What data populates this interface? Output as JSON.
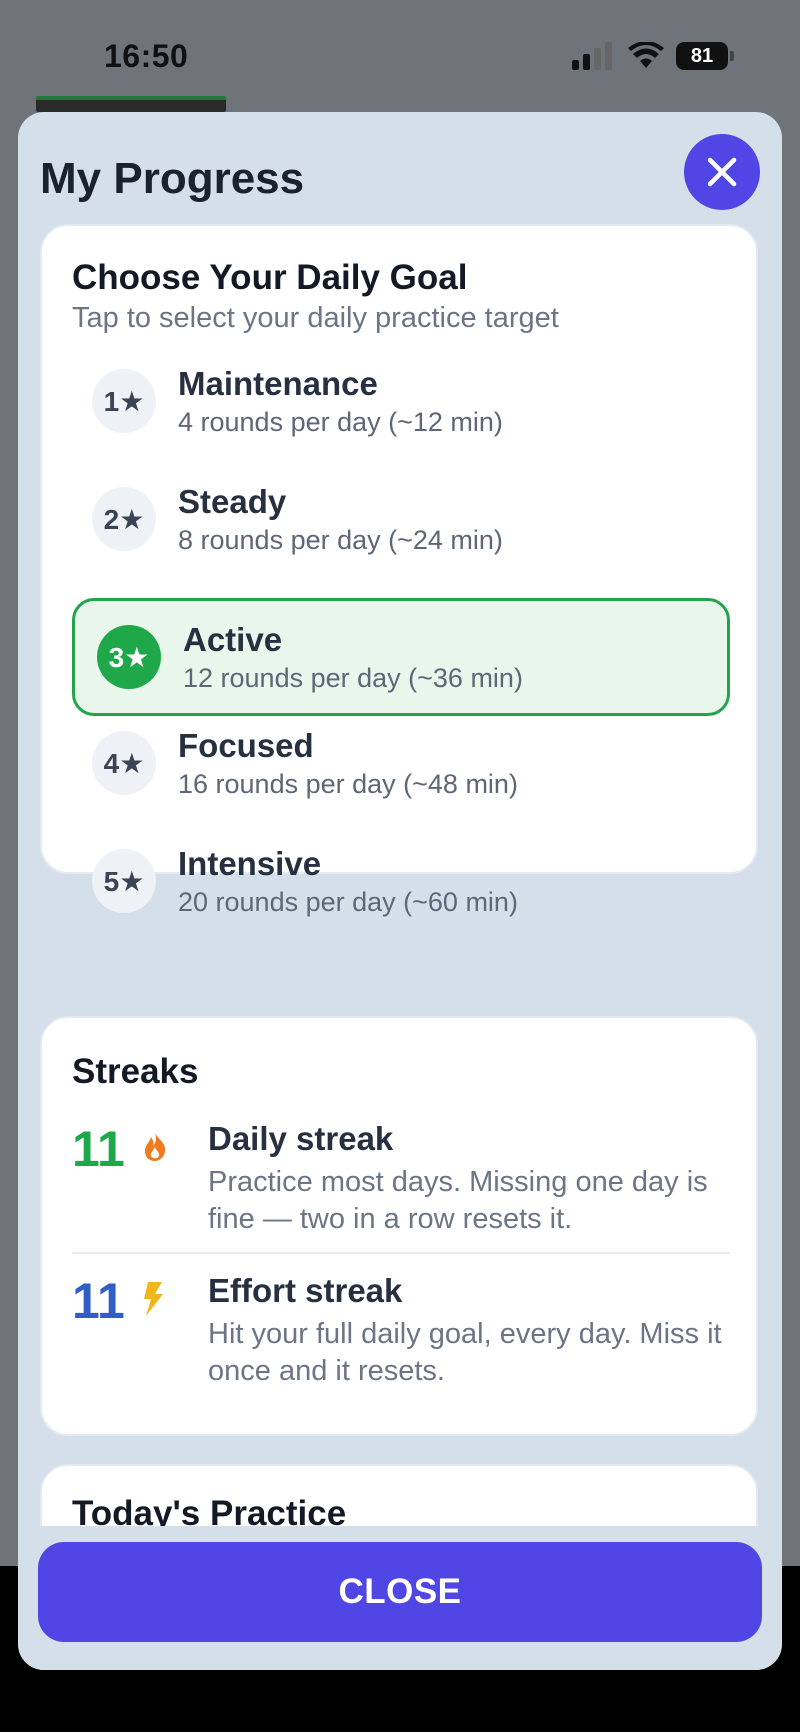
{
  "status_bar": {
    "time": "16:50",
    "battery": "81"
  },
  "modal": {
    "title": "My Progress"
  },
  "daily_goal": {
    "title": "Choose Your Daily Goal",
    "subtitle": "Tap to select your daily practice target",
    "options": [
      {
        "badge": "1★",
        "name": "Maintenance",
        "desc": "4 rounds per day (~12 min)",
        "selected": false
      },
      {
        "badge": "2★",
        "name": "Steady",
        "desc": "8 rounds per day (~24 min)",
        "selected": false
      },
      {
        "badge": "3★",
        "name": "Active",
        "desc": "12 rounds per day (~36 min)",
        "selected": true
      },
      {
        "badge": "4★",
        "name": "Focused",
        "desc": "16 rounds per day (~48 min)",
        "selected": false
      },
      {
        "badge": "5★",
        "name": "Intensive",
        "desc": "20 rounds per day (~60 min)",
        "selected": false
      }
    ]
  },
  "streaks": {
    "title": "Streaks",
    "items": [
      {
        "count": "11",
        "icon": "flame-icon",
        "color": "#1fa84a",
        "name": "Daily streak",
        "desc": "Practice most days. Missing one day is fine — two in a row resets it."
      },
      {
        "count": "11",
        "icon": "lightning-icon",
        "color": "#2f5fc4",
        "name": "Effort streak",
        "desc": "Hit your full daily goal, every day. Miss it once and it resets."
      }
    ]
  },
  "today": {
    "title": "Today's Practice"
  },
  "footer": {
    "close_label": "CLOSE"
  },
  "colors": {
    "accent": "#4f46e5",
    "selected": "#22a54a",
    "flame": "#f07a1e",
    "bolt": "#f2b61b"
  }
}
